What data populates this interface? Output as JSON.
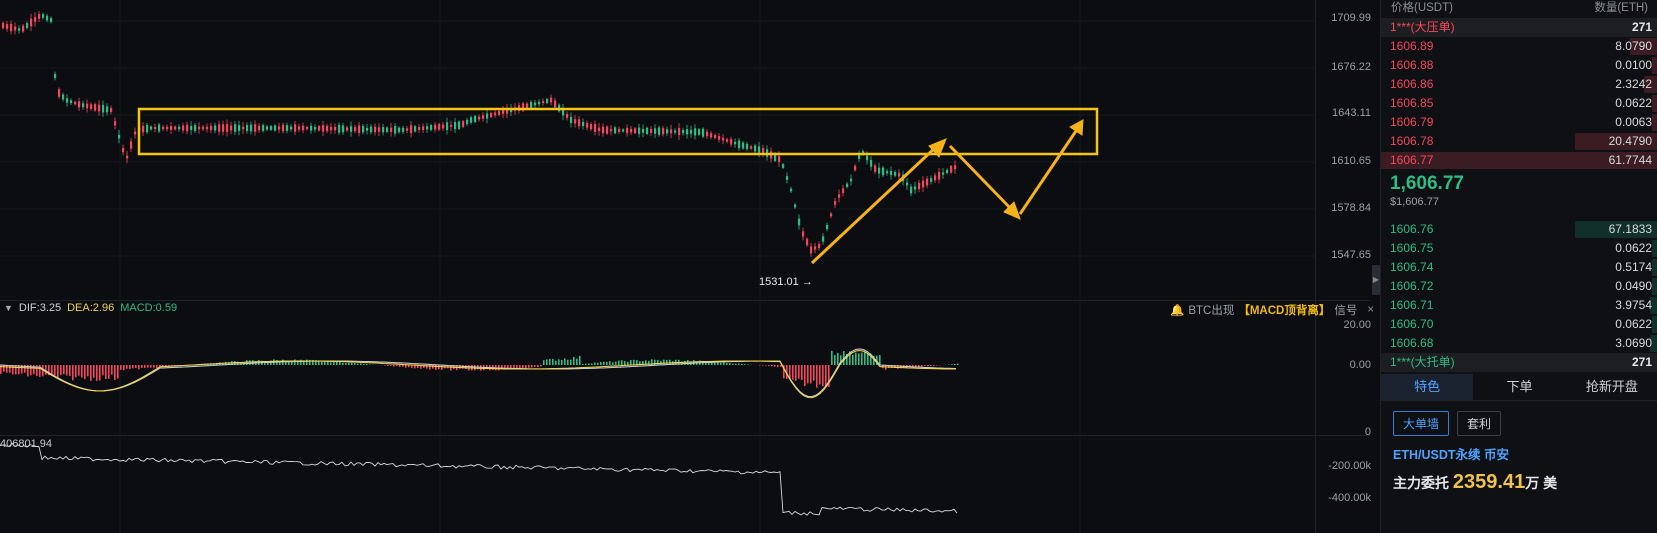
{
  "price_axis": {
    "labels": [
      "1709.99",
      "1676.22",
      "1643.11",
      "1610.65",
      "1578.84",
      "1547.65"
    ]
  },
  "low_marker": "1531.01",
  "macd": {
    "dif_label": "DIF:3.25",
    "dea_label": "DEA:2.96",
    "macd_label": "MACD:0.59",
    "axis_top": "20.00",
    "axis_zero": "0.00",
    "colors": {
      "dif": "#f0d44a",
      "dea": "#c9ccd1",
      "up": "#2ebd85",
      "down": "#f6465d"
    }
  },
  "signal": {
    "prefix": "BTC出现",
    "highlight": "【MACD顶背离】",
    "suffix": "信号",
    "close": "×"
  },
  "volume": {
    "value_label": "406801.94",
    "axis": [
      "0",
      "-200.00k",
      "-400.00k"
    ]
  },
  "orderbook": {
    "header_price": "价格(USDT)",
    "header_qty": "数量(ETH)",
    "big_sell_label": "1***(大压单)",
    "big_sell_qty": "271",
    "asks": [
      {
        "price": "1606.89",
        "qty": "8.0790",
        "depth": 0.1
      },
      {
        "price": "1606.88",
        "qty": "0.0100",
        "depth": 0.02
      },
      {
        "price": "1606.86",
        "qty": "2.3242",
        "depth": 0.05
      },
      {
        "price": "1606.85",
        "qty": "0.0622",
        "depth": 0.02
      },
      {
        "price": "1606.79",
        "qty": "0.0063",
        "depth": 0.02
      },
      {
        "price": "1606.78",
        "qty": "20.4790",
        "depth": 0.3
      },
      {
        "price": "1606.77",
        "qty": "61.7744",
        "depth": 1.0
      }
    ],
    "mid_price": "1,606.77",
    "mid_usd": "$1,606.77",
    "bids": [
      {
        "price": "1606.76",
        "qty": "67.1833",
        "depth": 0.3
      },
      {
        "price": "1606.75",
        "qty": "0.0622",
        "depth": 0.02
      },
      {
        "price": "1606.74",
        "qty": "0.5174",
        "depth": 0.02
      },
      {
        "price": "1606.72",
        "qty": "0.0490",
        "depth": 0.02
      },
      {
        "price": "1606.71",
        "qty": "3.9754",
        "depth": 0.03
      },
      {
        "price": "1606.70",
        "qty": "0.0622",
        "depth": 0.02
      },
      {
        "price": "1606.68",
        "qty": "3.0690",
        "depth": 0.03
      }
    ],
    "big_buy_label": "1***(大托单)",
    "big_buy_qty": "271",
    "tabs": [
      "特色",
      "下单",
      "抢新开盘"
    ],
    "chips": [
      "大单墙",
      "套利"
    ],
    "pair": "ETH/USDT永续 币安",
    "main_label": "主力委托",
    "main_value": "2359.41",
    "main_unit": "万 美"
  }
}
